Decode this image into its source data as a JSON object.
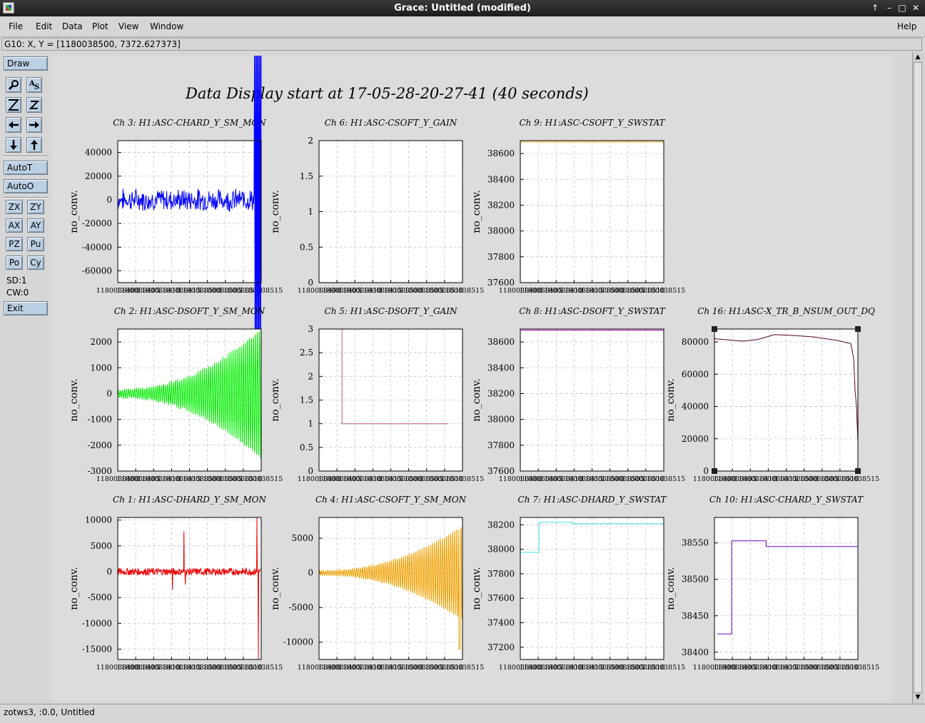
{
  "window": {
    "title": "Grace: Untitled (modified)",
    "controls": [
      "↑",
      "–",
      "□",
      "✕"
    ]
  },
  "menubar": {
    "left": [
      "File",
      "Edit",
      "Data",
      "Plot",
      "View",
      "Window"
    ],
    "help": "Help"
  },
  "locator": "G10: X, Y = [1180038500, 7372.627373]",
  "toolpanel": {
    "draw": "Draw",
    "autot": "AutoT",
    "autoo": "AutoO",
    "zx": "ZX",
    "zy": "ZY",
    "ax": "AX",
    "ay": "AY",
    "pz": "PZ",
    "pu": "Pu",
    "po": "Po",
    "cy": "Cy",
    "sd": "SD:1",
    "cw": "CW:0",
    "exit": "Exit",
    "icons": [
      "magnifier-icon",
      "text-as-icon",
      "zoom-z-icon",
      "zoom-small-z-icon",
      "arrow-left-icon",
      "arrow-right-icon",
      "arrow-down-icon",
      "arrow-up-icon"
    ]
  },
  "status": "zotws3, :0.0, Untitled",
  "figure_title": "Data Display start at 17-05-28-20-27-41 (40 seconds)",
  "xtick_labels": [
    "1180038400",
    "1180038405",
    "1180038410",
    "1180038415",
    "1180038500",
    "1180038505",
    "1180038510",
    "1180038515"
  ],
  "chart_data": [
    {
      "type": "line",
      "title": "Ch 3: H1:ASC-CHARD_Y_SM_MON",
      "ylabel": "no_conv.",
      "xlim": [
        1180038475,
        1180038515
      ],
      "ylim": [
        -70000,
        50000
      ],
      "yticks": [
        40000,
        20000,
        0,
        -20000,
        -40000,
        -60000
      ],
      "ytick_labels": [
        "40000",
        "20000",
        "0",
        "-20000",
        "-40000",
        "-60000"
      ],
      "color": "#0000ff",
      "pattern": "noise_burst",
      "params": {
        "amp": 8000,
        "burst_start": 0.95,
        "burst_amp": 130000
      }
    },
    {
      "type": "line",
      "title": "Ch 6: H1:ASC-CSOFT_Y_GAIN",
      "ylabel": "no_conv.",
      "xlim": [
        1180038475,
        1180038515
      ],
      "ylim": [
        0,
        2
      ],
      "yticks": [
        2,
        1.5,
        1,
        0.5,
        0
      ],
      "ytick_labels": [
        "2",
        "1.5",
        "1",
        "0.5",
        "0"
      ],
      "color": "#ff0000",
      "pattern": "none",
      "params": {}
    },
    {
      "type": "line",
      "title": "Ch 9: H1:ASC-CSOFT_Y_SWSTAT",
      "ylabel": "no_conv.",
      "xlim": [
        1180038475,
        1180038515
      ],
      "ylim": [
        37600,
        38700
      ],
      "yticks": [
        38600,
        38400,
        38200,
        38000,
        37800,
        37600
      ],
      "ytick_labels": [
        "38600",
        "38400",
        "38200",
        "38000",
        "37800",
        "37600"
      ],
      "color": "#e8a000",
      "pattern": "steps",
      "params": {
        "steps": [
          [
            0,
            38690
          ],
          [
            1,
            38690
          ]
        ]
      }
    },
    {
      "type": "line",
      "title": "Ch 2: H1:ASC-DSOFT_Y_SM_MON",
      "ylabel": "no_conv.",
      "xlim": [
        1180038475,
        1180038515
      ],
      "ylim": [
        -3000,
        2500
      ],
      "yticks": [
        2000,
        1000,
        0,
        -1000,
        -2000,
        -3000
      ],
      "ytick_labels": [
        "2000",
        "1000",
        "0",
        "-1000",
        "-2000",
        "-3000"
      ],
      "color": "#00ee00",
      "pattern": "growing_osc",
      "params": {
        "amp0": 150,
        "amp1": 2600,
        "freq": 70
      }
    },
    {
      "type": "line",
      "title": "Ch 5: H1:ASC-DSOFT_Y_GAIN",
      "ylabel": "no_conv.",
      "xlim": [
        1180038475,
        1180038515
      ],
      "ylim": [
        0,
        3
      ],
      "yticks": [
        3,
        2.5,
        2,
        1.5,
        1,
        0.5,
        0
      ],
      "ytick_labels": [
        "3",
        "2.5",
        "2",
        "1.5",
        "1",
        "0.5",
        "0"
      ],
      "color": "#c06060",
      "pattern": "steps",
      "params": {
        "steps": [
          [
            0.16,
            3
          ],
          [
            0.16,
            1
          ],
          [
            0.9,
            1
          ]
        ]
      }
    },
    {
      "type": "line",
      "title": "Ch 8: H1:ASC-DSOFT_Y_SWSTAT",
      "ylabel": "no_conv.",
      "xlim": [
        1180038475,
        1180038515
      ],
      "ylim": [
        37600,
        38700
      ],
      "yticks": [
        38600,
        38400,
        38200,
        38000,
        37800,
        37600
      ],
      "ytick_labels": [
        "38600",
        "38400",
        "38200",
        "38000",
        "37800",
        "37600"
      ],
      "color": "#b000b0",
      "pattern": "steps",
      "params": {
        "steps": [
          [
            0,
            38690
          ],
          [
            1,
            38690
          ]
        ]
      }
    },
    {
      "type": "line",
      "title": "Ch 16: H1:ASC-X_TR_B_NSUM_OUT_DQ",
      "ylabel": "no_conv.",
      "xlim": [
        1180038475,
        1180038515
      ],
      "ylim": [
        0,
        88000
      ],
      "yticks": [
        80000,
        60000,
        40000,
        20000,
        0
      ],
      "ytick_labels": [
        "80000",
        "60000",
        "40000",
        "20000",
        "0"
      ],
      "color": "#5a0030",
      "pattern": "drift_drop",
      "params": {
        "points": [
          [
            0,
            82000
          ],
          [
            0.2,
            80500
          ],
          [
            0.3,
            81500
          ],
          [
            0.42,
            84500
          ],
          [
            0.55,
            84000
          ],
          [
            0.7,
            83000
          ],
          [
            0.85,
            81000
          ],
          [
            0.95,
            79000
          ],
          [
            0.97,
            70000
          ],
          [
            0.98,
            50000
          ],
          [
            0.99,
            40000
          ],
          [
            1,
            18000
          ]
        ]
      }
    },
    {
      "type": "line",
      "title": "Ch 1: H1:ASC-DHARD_Y_SM_MON",
      "ylabel": "no_conv.",
      "xlim": [
        1180038475,
        1180038515
      ],
      "ylim": [
        -17000,
        10500
      ],
      "yticks": [
        10000,
        5000,
        0,
        -5000,
        -10000,
        -15000
      ],
      "ytick_labels": [
        "10000",
        "5000",
        "0",
        "-5000",
        "-10000",
        "-15000"
      ],
      "color": "#ee0000",
      "pattern": "noise_spikes",
      "params": {
        "amp": 700,
        "spikes": [
          [
            0.46,
            7800
          ],
          [
            0.47,
            -2500
          ],
          [
            0.38,
            -3500
          ],
          [
            0.97,
            10500
          ],
          [
            0.98,
            -17000
          ]
        ]
      }
    },
    {
      "type": "line",
      "title": "Ch 4: H1:ASC-CSOFT_Y_SM_MON",
      "ylabel": "no_conv.",
      "xlim": [
        1180038475,
        1180038515
      ],
      "ylim": [
        -12500,
        8000
      ],
      "yticks": [
        5000,
        0,
        -5000,
        -10000
      ],
      "ytick_labels": [
        "5000",
        "0",
        "-5000",
        "-10000"
      ],
      "color": "#f0a000",
      "pattern": "growing_osc",
      "params": {
        "amp0": 300,
        "amp1": 7000,
        "freq": 70,
        "tail_drop": -11000
      }
    },
    {
      "type": "line",
      "title": "Ch 7: H1:ASC-DHARD_Y_SWSTAT",
      "ylabel": "no_conv.",
      "xlim": [
        1180038475,
        1180038515
      ],
      "ylim": [
        37100,
        38260
      ],
      "yticks": [
        38200,
        38000,
        37800,
        37600,
        37400,
        37200
      ],
      "ytick_labels": [
        "38200",
        "38000",
        "37800",
        "37600",
        "37400",
        "37200"
      ],
      "color": "#40e0f0",
      "pattern": "steps",
      "params": {
        "steps": [
          [
            0,
            37975
          ],
          [
            0.13,
            37975
          ],
          [
            0.13,
            38220
          ],
          [
            0.37,
            38220
          ],
          [
            0.37,
            38210
          ],
          [
            1,
            38210
          ]
        ]
      }
    },
    {
      "type": "line",
      "title": "Ch 10: H1:ASC-CHARD_Y_SWSTAT",
      "ylabel": "no_conv.",
      "xlim": [
        1180038475,
        1180038515
      ],
      "ylim": [
        38390,
        38585
      ],
      "yticks": [
        38550,
        38500,
        38450,
        38400
      ],
      "ytick_labels": [
        "38550",
        "38500",
        "38450",
        "38400"
      ],
      "color": "#7000c0",
      "pattern": "steps",
      "params": {
        "steps": [
          [
            0.02,
            38425
          ],
          [
            0.12,
            38425
          ],
          [
            0.12,
            38553
          ],
          [
            0.36,
            38553
          ],
          [
            0.36,
            38545
          ],
          [
            1,
            38545
          ]
        ]
      }
    }
  ],
  "panel_positions_note": ""
}
